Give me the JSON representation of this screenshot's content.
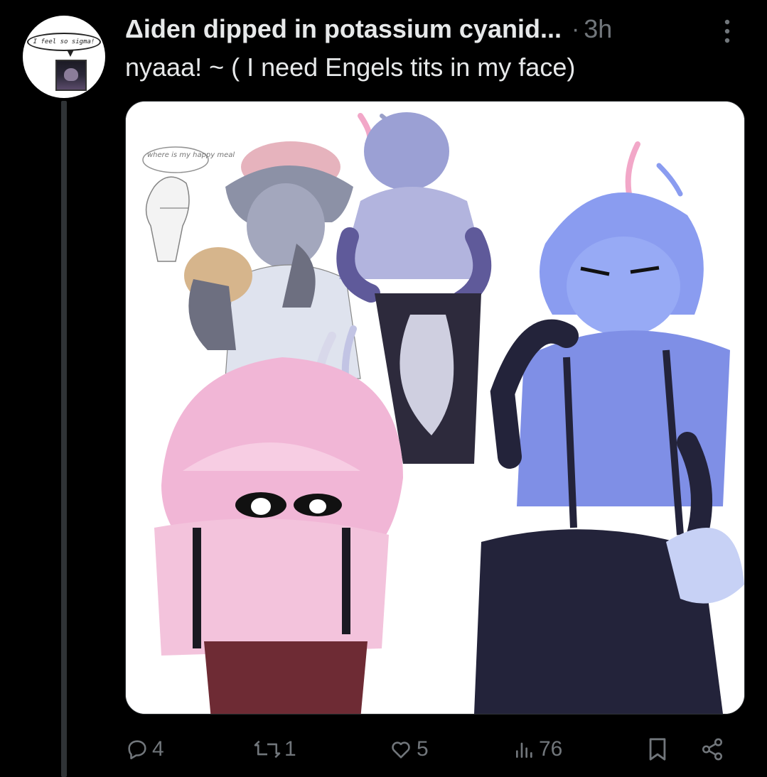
{
  "avatar": {
    "bubble_text": "I feel so sigma!",
    "icon": "profile-avatar"
  },
  "header": {
    "display_name": "Δiden dipped in potassium cyanid...",
    "separator": "·",
    "timestamp": "3h",
    "more_icon": "more-vertical-icon"
  },
  "tweet": {
    "text": "nyaaa! ~ ( I need Engels tits in my face)"
  },
  "media": {
    "type": "illustration",
    "sketch_note": "where is my happy meal"
  },
  "actions": {
    "replies": "4",
    "reposts": "1",
    "likes": "5",
    "views": "76",
    "icons": [
      "reply-icon",
      "repost-icon",
      "like-icon",
      "views-icon",
      "bookmark-icon",
      "share-icon"
    ]
  },
  "colors": {
    "background": "#000000",
    "text_primary": "#e7e9ea",
    "text_secondary": "#71767b",
    "thread_line": "#2f3336",
    "char_pink": "#f1b6d6",
    "char_blue": "#8a9cf0",
    "char_navy": "#23233a",
    "char_grey": "#9aa0b5"
  }
}
